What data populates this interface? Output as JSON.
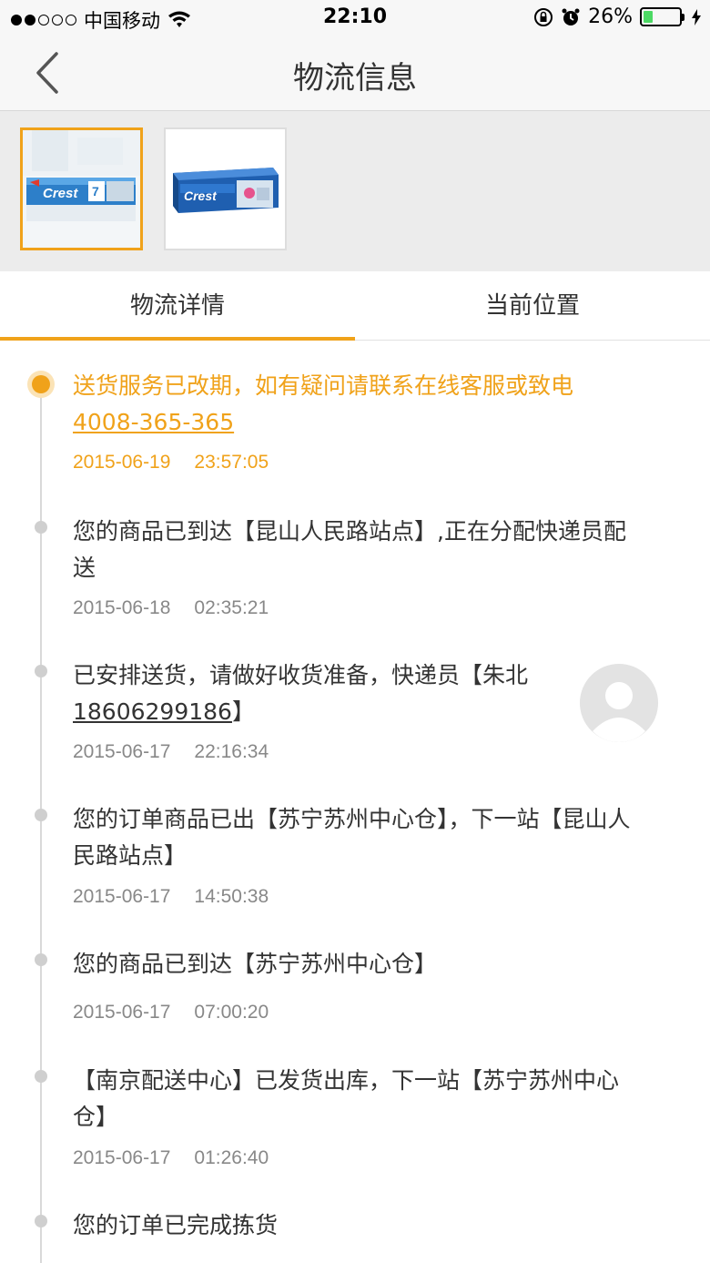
{
  "status_bar": {
    "carrier": "中国移动",
    "time": "22:10",
    "battery_percent": "26%",
    "signal_filled": 2,
    "signal_total": 5
  },
  "nav": {
    "title": "物流信息"
  },
  "tabs": [
    {
      "label": "物流详情",
      "selected": true
    },
    {
      "label": "当前位置",
      "selected": false
    }
  ],
  "colors": {
    "accent": "#f0a21a",
    "text": "#333333",
    "muted": "#888888"
  },
  "timeline": [
    {
      "text": "送货服务已改期，如有疑问请联系在线客服或致电",
      "phone": "4008-365-365",
      "date": "2015-06-19",
      "time": "23:57:05",
      "active": true
    },
    {
      "text": "您的商品已到达【昆山人民路站点】,正在分配快递员配送",
      "date": "2015-06-18",
      "time": "02:35:21"
    },
    {
      "text": "已安排送货，请做好收货准备，快递员【朱北",
      "phone": "18606299186",
      "suffix": "】",
      "date": "2015-06-17",
      "time": "22:16:34",
      "has_avatar": true
    },
    {
      "text": "您的订单商品已出【苏宁苏州中心仓】，下一站【昆山人民路站点】",
      "date": "2015-06-17",
      "time": "14:50:38"
    },
    {
      "text": "您的商品已到达【苏宁苏州中心仓】",
      "date": "2015-06-17",
      "time": "07:00:20"
    },
    {
      "text": "【南京配送中心】已发货出库，下一站【苏宁苏州中心仓】",
      "date": "2015-06-17",
      "time": "01:26:40"
    },
    {
      "text": "您的订单已完成拣货"
    }
  ]
}
